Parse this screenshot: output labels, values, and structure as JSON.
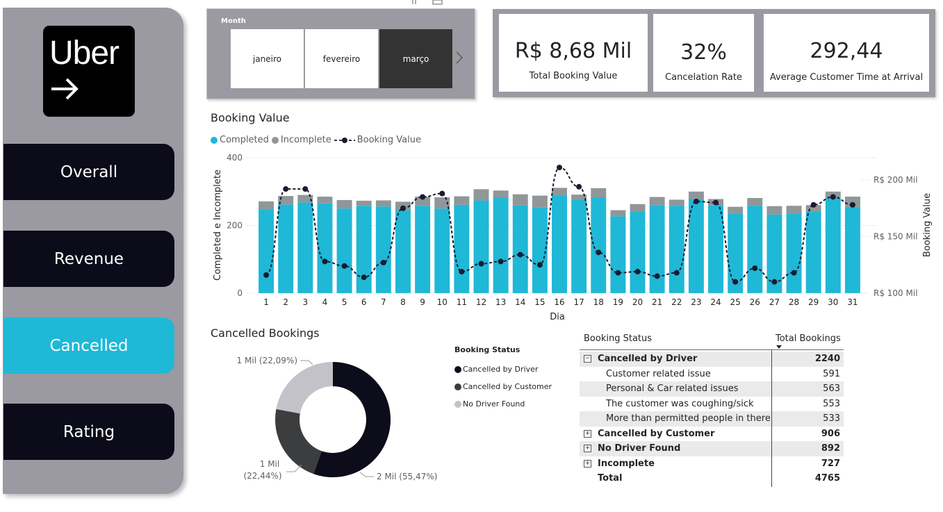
{
  "sidebar": {
    "logo_text": "Uber",
    "nav": [
      {
        "label": "Overall",
        "active": false
      },
      {
        "label": "Revenue",
        "active": false
      },
      {
        "label": "Cancelled",
        "active": true
      },
      {
        "label": "Rating",
        "active": false
      }
    ]
  },
  "slicer": {
    "title": "Month",
    "months": [
      "janeiro",
      "fevereiro",
      "março"
    ],
    "selected": "março"
  },
  "kpis": [
    {
      "value": "R$ 8,68 Mil",
      "label": "Total Booking Value"
    },
    {
      "value": "32%",
      "label": "Cancelation Rate"
    },
    {
      "value": "292,44",
      "label": "Average Customer Time at Arrival"
    }
  ],
  "booking_chart_title": "Booking Value",
  "cancelled_chart_title": "Cancelled Bookings",
  "colors": {
    "accent": "#1fb8d7",
    "incomplete": "#8f9799",
    "line": "#1b1b2f",
    "sidebar": "#9b9aa2",
    "nav_dark": "#0b0b19",
    "driver": "#0d0c1a",
    "customer": "#3b3d3e",
    "no_driver": "#c2c2c8"
  },
  "chart_data": [
    {
      "type": "bar",
      "stacked": true,
      "title": "Booking Value",
      "xlabel": "Dia",
      "ylabel": "Completed e Incomplete",
      "y2label": "Booking Value",
      "legend": [
        "Completed",
        "Incomplete",
        "Booking Value"
      ],
      "legend_position": "top-left",
      "categories": [
        "1",
        "2",
        "3",
        "4",
        "5",
        "6",
        "7",
        "8",
        "9",
        "10",
        "11",
        "12",
        "13",
        "14",
        "15",
        "16",
        "17",
        "18",
        "19",
        "20",
        "21",
        "22",
        "23",
        "24",
        "25",
        "26",
        "27",
        "28",
        "29",
        "30",
        "31"
      ],
      "ylim": [
        0,
        400
      ],
      "yticks": [
        "0",
        "200",
        "400"
      ],
      "y2lim": [
        100,
        200
      ],
      "y2ticks": [
        "R$ 100 Mil",
        "R$ 150 Mil",
        "R$ 200 Mil"
      ],
      "grid": "dotted horizontal",
      "series": [
        {
          "name": "Completed",
          "kind": "bar",
          "values": [
            248,
            262,
            268,
            265,
            250,
            258,
            256,
            245,
            258,
            250,
            261,
            274,
            283,
            259,
            253,
            290,
            276,
            282,
            227,
            240,
            260,
            258,
            278,
            260,
            235,
            258,
            232,
            235,
            240,
            280,
            255
          ]
        },
        {
          "name": "Incomplete",
          "kind": "bar",
          "values": [
            23,
            25,
            22,
            20,
            25,
            15,
            18,
            25,
            27,
            33,
            25,
            33,
            20,
            33,
            35,
            21,
            15,
            28,
            18,
            23,
            24,
            18,
            22,
            18,
            20,
            23,
            25,
            23,
            20,
            20,
            30
          ]
        },
        {
          "name": "Booking Value",
          "kind": "line",
          "axis": "secondary",
          "unit": "R$ Mil",
          "values": [
            116,
            192,
            192,
            128,
            124,
            114,
            127,
            175,
            185,
            188,
            119,
            126,
            128,
            134,
            125,
            211,
            194,
            136,
            118,
            119,
            115,
            118,
            181,
            180,
            110,
            122,
            110,
            118,
            178,
            185,
            178
          ]
        }
      ]
    },
    {
      "type": "pie",
      "donut": true,
      "title": "Cancelled Bookings",
      "legend_title": "Booking Status",
      "legend_position": "right",
      "labels": [
        "Cancelled by Driver",
        "Cancelled by Customer",
        "No Driver Found"
      ],
      "values": [
        55.47,
        22.44,
        22.09
      ],
      "data_labels": [
        "2 Mil (55,47%)",
        "1 Mil (22,44%)",
        "1 Mil (22,09%)"
      ]
    }
  ],
  "matrix": {
    "headers": [
      "Booking Status",
      "Total Bookings"
    ],
    "rows": [
      {
        "label": "Cancelled by Driver",
        "value": "2240",
        "level": 0,
        "expand": "⊟"
      },
      {
        "label": "Customer related issue",
        "value": "591",
        "level": 1
      },
      {
        "label": "Personal & Car related issues",
        "value": "563",
        "level": 1
      },
      {
        "label": "The customer was coughing/sick",
        "value": "553",
        "level": 1
      },
      {
        "label": "More than permitted people in there",
        "value": "533",
        "level": 1
      },
      {
        "label": "Cancelled by Customer",
        "value": "906",
        "level": 0,
        "expand": "⊞"
      },
      {
        "label": "No Driver Found",
        "value": "892",
        "level": 0,
        "expand": "⊞"
      },
      {
        "label": "Incomplete",
        "value": "727",
        "level": 0,
        "expand": "⊞"
      },
      {
        "label": "Total",
        "value": "4765",
        "level": 0,
        "total": true
      }
    ]
  }
}
